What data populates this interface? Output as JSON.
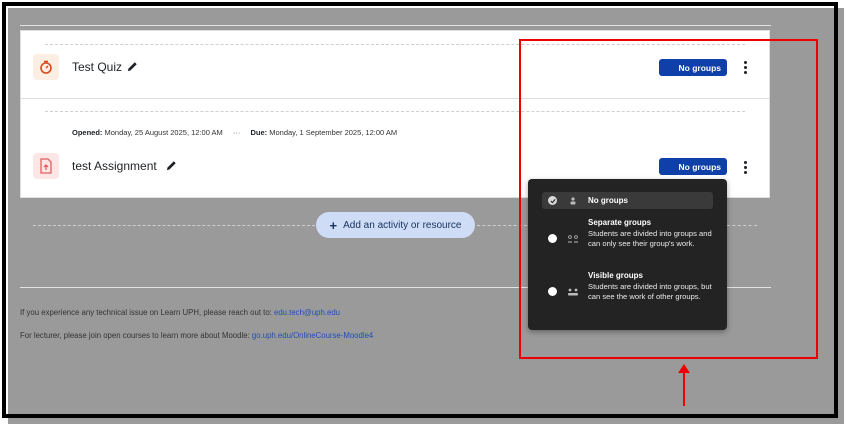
{
  "activities": [
    {
      "name": "Test Quiz",
      "icon": "stopwatch-icon",
      "groups_badge": "No groups"
    },
    {
      "name": "test Assignment",
      "icon": "assignment-upload-icon",
      "groups_badge": "No groups",
      "dates": {
        "opened_label": "Opened:",
        "opened_value": "Monday, 25 August 2025, 12:00 AM",
        "separator": "···",
        "due_label": "Due:",
        "due_value": "Monday, 1 September 2025, 12:00 AM"
      }
    }
  ],
  "add_activity": {
    "label": "Add an activity or resource"
  },
  "group_mode_menu": {
    "options": [
      {
        "title": "No groups",
        "description": "",
        "selected": true
      },
      {
        "title": "Separate groups",
        "description": "Students are divided into groups and can only see their group's work.",
        "selected": false
      },
      {
        "title": "Visible groups",
        "description": "Students are divided into groups, but can see the work of other groups.",
        "selected": false
      }
    ]
  },
  "footer": {
    "line1_text": "If you experience any technical issue on Learn UPH, please reach out to:",
    "line1_link": "edu.tech@uph.edu",
    "line2_text": "For lecturer, please join open courses to learn more about Moodle:",
    "line2_link": "go.uph.edu/OnlineCourse-Moodle4"
  },
  "colors": {
    "badge": "#0f3fa8",
    "annotation": "#ee0000",
    "menu_bg": "#232323",
    "add_button": "#cfdcf5",
    "link": "#1f4fb8"
  }
}
